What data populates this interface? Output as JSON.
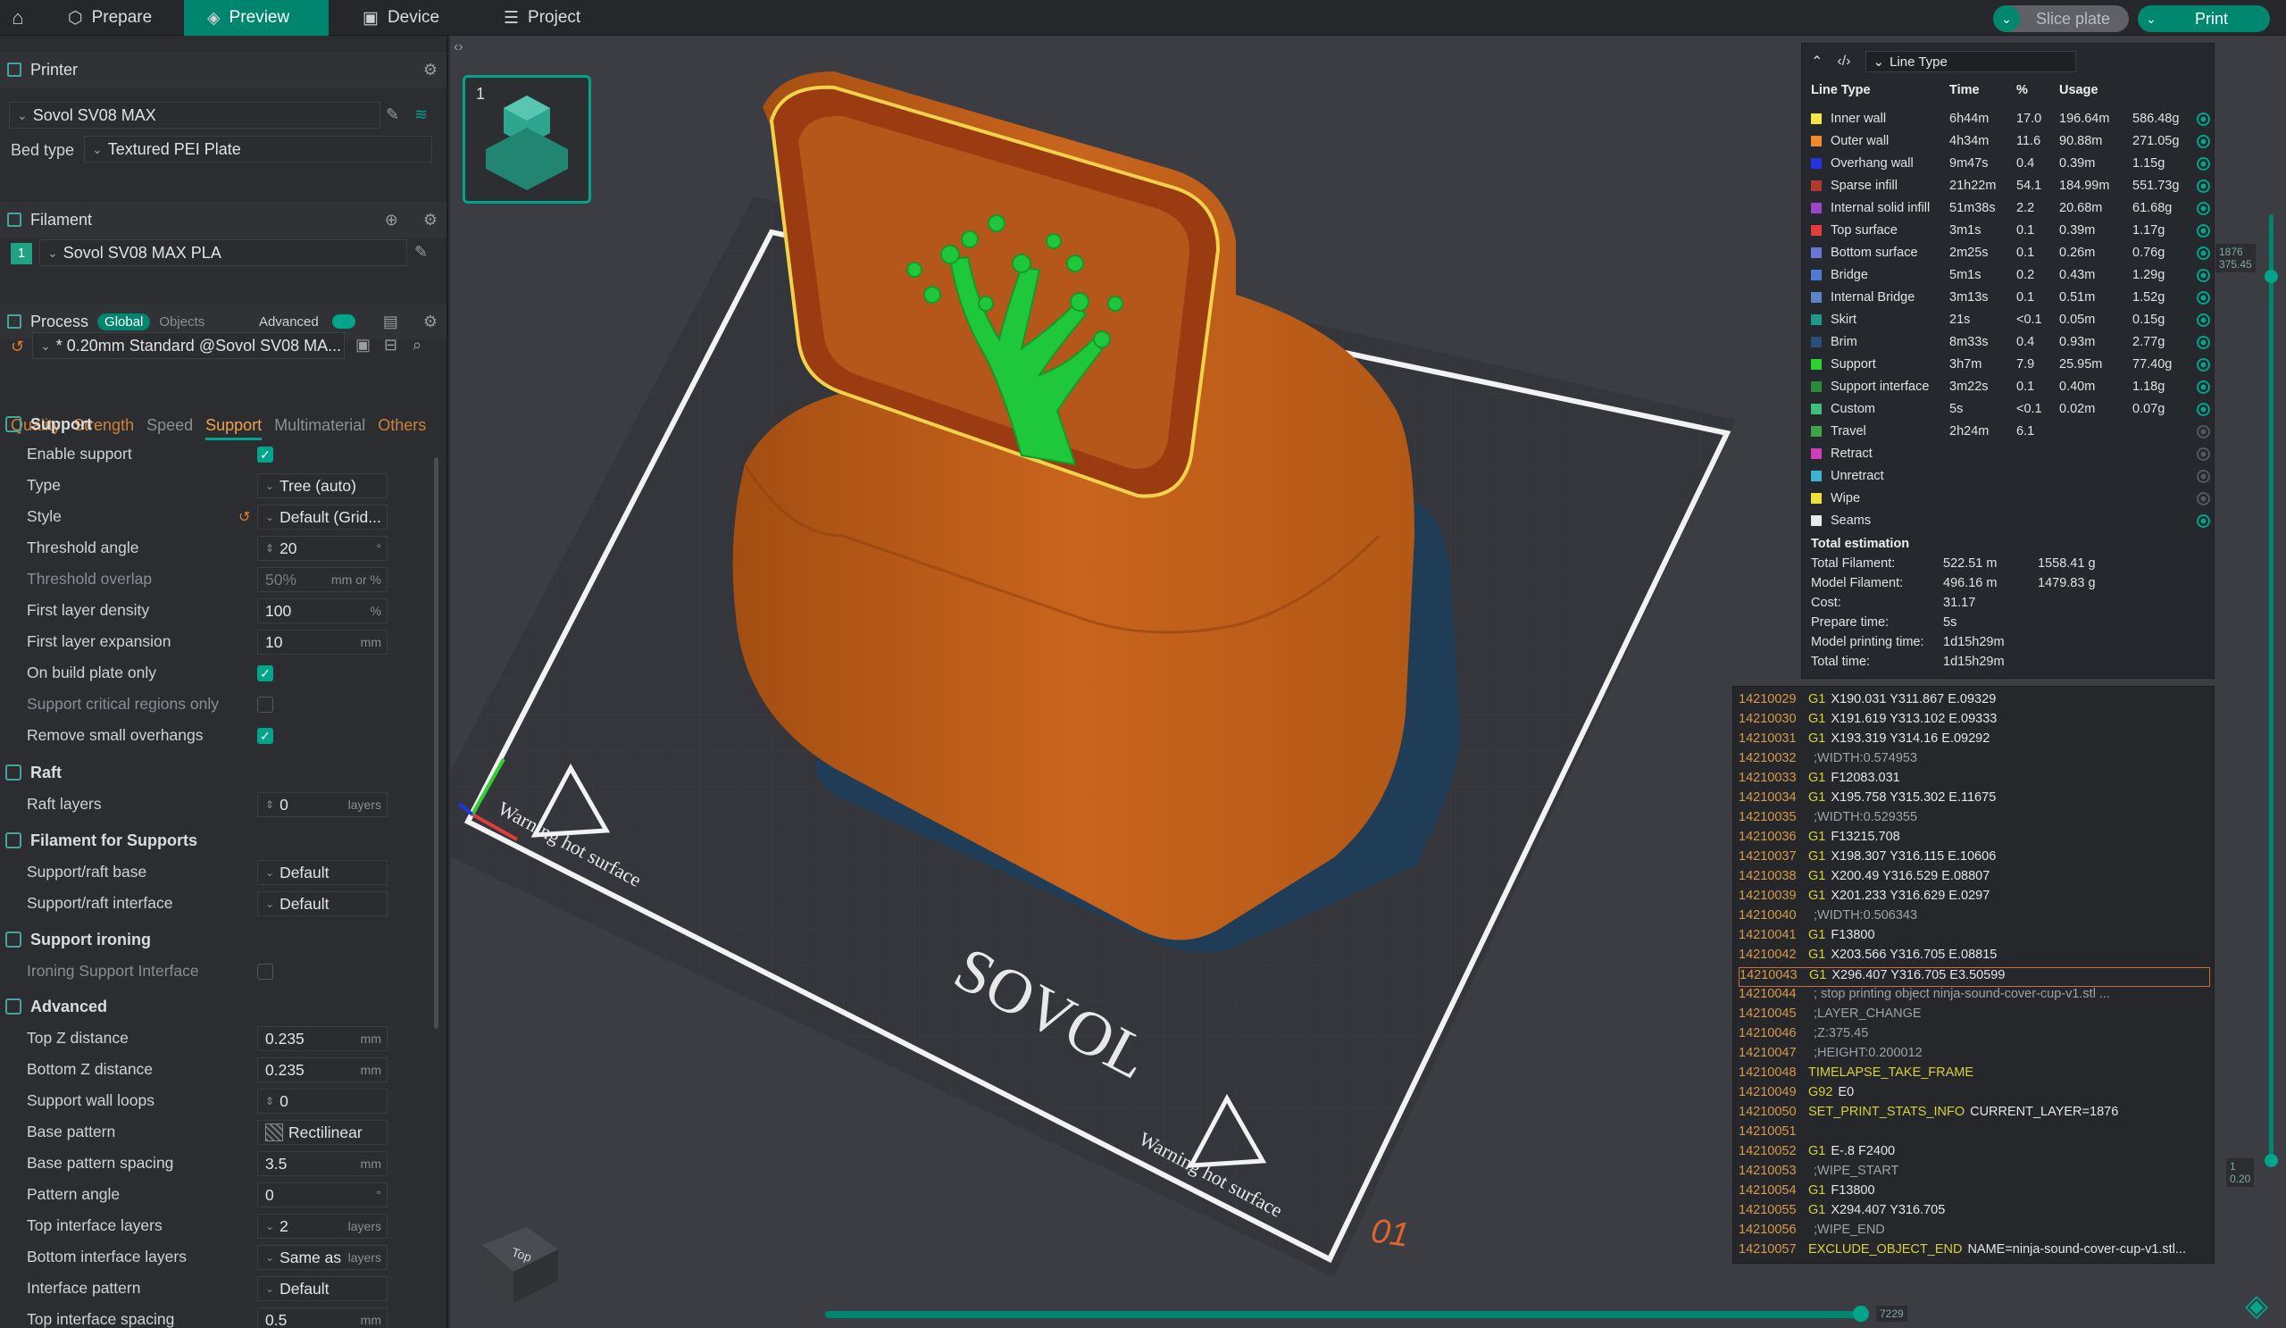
{
  "topbar": {
    "tabs": [
      {
        "label": "Prepare",
        "active": false
      },
      {
        "label": "Preview",
        "active": true
      },
      {
        "label": "Device",
        "active": false
      },
      {
        "label": "Project",
        "active": false
      }
    ],
    "slice_label": "Slice plate",
    "print_label": "Print"
  },
  "printer": {
    "title": "Printer",
    "name": "Sovol SV08 MAX",
    "bed_type_label": "Bed type",
    "bed_type_value": "Textured PEI Plate"
  },
  "filament": {
    "title": "Filament",
    "slot": "1",
    "name": "Sovol SV08 MAX PLA"
  },
  "process": {
    "title": "Process",
    "global": "Global",
    "objects": "Objects",
    "advanced": "Advanced",
    "preset": "* 0.20mm Standard @Sovol SV08 MA...",
    "tabs": [
      "Quality",
      "Strength",
      "Speed",
      "Support",
      "Multimaterial",
      "Others"
    ]
  },
  "support": {
    "group": "Support",
    "enable_label": "Enable support",
    "type_label": "Type",
    "type_value": "Tree (auto)",
    "style_label": "Style",
    "style_value": "Default (Grid...",
    "threshold_angle_label": "Threshold angle",
    "threshold_angle_value": "20",
    "threshold_angle_unit": "°",
    "threshold_overlap_label": "Threshold overlap",
    "threshold_overlap_value": "50%",
    "threshold_overlap_unit": "mm or %",
    "first_layer_density_label": "First layer density",
    "first_layer_density_value": "100",
    "first_layer_density_unit": "%",
    "first_layer_expansion_label": "First layer expansion",
    "first_layer_expansion_value": "10",
    "first_layer_expansion_unit": "mm",
    "on_build_plate_label": "On build plate only",
    "critical_regions_label": "Support critical regions only",
    "remove_small_label": "Remove small overhangs"
  },
  "raft": {
    "group": "Raft",
    "layers_label": "Raft layers",
    "layers_value": "0",
    "layers_unit": "layers"
  },
  "filament_supports": {
    "group": "Filament for Supports",
    "base_label": "Support/raft base",
    "base_value": "Default",
    "interface_label": "Support/raft interface",
    "interface_value": "Default"
  },
  "support_ironing": {
    "group": "Support ironing",
    "label": "Ironing Support Interface"
  },
  "advanced": {
    "group": "Advanced",
    "top_z_label": "Top Z distance",
    "top_z_value": "0.235",
    "top_z_unit": "mm",
    "bottom_z_label": "Bottom Z distance",
    "bottom_z_value": "0.235",
    "bottom_z_unit": "mm",
    "wall_loops_label": "Support wall loops",
    "wall_loops_value": "0",
    "base_pattern_label": "Base pattern",
    "base_pattern_value": "Rectilinear",
    "base_spacing_label": "Base pattern spacing",
    "base_spacing_value": "3.5",
    "base_spacing_unit": "mm",
    "pattern_angle_label": "Pattern angle",
    "pattern_angle_value": "0",
    "pattern_angle_unit": "°",
    "top_iface_label": "Top interface layers",
    "top_iface_value": "2",
    "top_iface_unit": "layers",
    "bottom_iface_label": "Bottom interface layers",
    "bottom_iface_value": "Same as",
    "bottom_iface_unit": "layers",
    "iface_pattern_label": "Interface pattern",
    "iface_pattern_value": "Default",
    "top_iface_spacing_label": "Top interface spacing",
    "top_iface_spacing_value": "0.5",
    "top_iface_spacing_unit": "mm"
  },
  "plate": {
    "number": "1",
    "bed_brand": "SOVOL",
    "warning": "Warning hot surface",
    "plate_id": "01",
    "view_cube_label": "Top"
  },
  "legend": {
    "selector": "Line Type",
    "headers": {
      "type": "Line Type",
      "time": "Time",
      "pct": "%",
      "usage": "Usage"
    },
    "rows": [
      {
        "name": "Inner wall",
        "time": "6h44m",
        "pct": "17.0",
        "len": "196.64m",
        "weight": "586.48g",
        "color": "#f5e44a",
        "visible": true
      },
      {
        "name": "Outer wall",
        "time": "4h34m",
        "pct": "11.6",
        "len": "90.88m",
        "weight": "271.05g",
        "color": "#f08a33",
        "visible": true
      },
      {
        "name": "Overhang wall",
        "time": "9m47s",
        "pct": "0.4",
        "len": "0.39m",
        "weight": "1.15g",
        "color": "#2233e0",
        "visible": true
      },
      {
        "name": "Sparse infill",
        "time": "21h22m",
        "pct": "54.1",
        "len": "184.99m",
        "weight": "551.73g",
        "color": "#b03a2e",
        "visible": true
      },
      {
        "name": "Internal solid infill",
        "time": "51m38s",
        "pct": "2.2",
        "len": "20.68m",
        "weight": "61.68g",
        "color": "#9b45c8",
        "visible": true
      },
      {
        "name": "Top surface",
        "time": "3m1s",
        "pct": "0.1",
        "len": "0.39m",
        "weight": "1.17g",
        "color": "#e33c3c",
        "visible": true
      },
      {
        "name": "Bottom surface",
        "time": "2m25s",
        "pct": "0.1",
        "len": "0.26m",
        "weight": "0.76g",
        "color": "#6a74d6",
        "visible": true
      },
      {
        "name": "Bridge",
        "time": "5m1s",
        "pct": "0.2",
        "len": "0.43m",
        "weight": "1.29g",
        "color": "#4f7ad1",
        "visible": true
      },
      {
        "name": "Internal Bridge",
        "time": "3m13s",
        "pct": "0.1",
        "len": "0.51m",
        "weight": "1.52g",
        "color": "#5a86c4",
        "visible": true
      },
      {
        "name": "Skirt",
        "time": "21s",
        "pct": "<0.1",
        "len": "0.05m",
        "weight": "0.15g",
        "color": "#1e9a8a",
        "visible": true
      },
      {
        "name": "Brim",
        "time": "8m33s",
        "pct": "0.4",
        "len": "0.93m",
        "weight": "2.77g",
        "color": "#2a4f7a",
        "visible": true
      },
      {
        "name": "Support",
        "time": "3h7m",
        "pct": "7.9",
        "len": "25.95m",
        "weight": "77.40g",
        "color": "#2fd12f",
        "visible": true
      },
      {
        "name": "Support interface",
        "time": "3m22s",
        "pct": "0.1",
        "len": "0.40m",
        "weight": "1.18g",
        "color": "#2b8a3a",
        "visible": true
      },
      {
        "name": "Custom",
        "time": "5s",
        "pct": "<0.1",
        "len": "0.02m",
        "weight": "0.07g",
        "color": "#3fbf7a",
        "visible": true
      },
      {
        "name": "Travel",
        "time": "2h24m",
        "pct": "6.1",
        "len": "",
        "weight": "",
        "color": "#3fa34a",
        "visible": false
      },
      {
        "name": "Retract",
        "time": "",
        "pct": "",
        "len": "",
        "weight": "",
        "color": "#d13fb8",
        "visible": false
      },
      {
        "name": "Unretract",
        "time": "",
        "pct": "",
        "len": "",
        "weight": "",
        "color": "#3fb3d1",
        "visible": false
      },
      {
        "name": "Wipe",
        "time": "",
        "pct": "",
        "len": "",
        "weight": "",
        "color": "#f0e03a",
        "visible": false
      },
      {
        "name": "Seams",
        "time": "",
        "pct": "",
        "len": "",
        "weight": "",
        "color": "#e8e8e8",
        "visible": true
      }
    ],
    "total_title": "Total estimation",
    "totals": [
      {
        "label": "Total Filament:",
        "v1": "522.51 m",
        "v2": "1558.41 g"
      },
      {
        "label": "Model Filament:",
        "v1": "496.16 m",
        "v2": "1479.83 g"
      },
      {
        "label": "Cost:",
        "v1": "31.17",
        "v2": ""
      },
      {
        "label": "Prepare time:",
        "v1": "5s",
        "v2": ""
      },
      {
        "label": "Model printing time:",
        "v1": "1d15h29m",
        "v2": ""
      },
      {
        "label": "Total time:",
        "v1": "1d15h29m",
        "v2": ""
      }
    ]
  },
  "gcode": [
    {
      "ln": "14210029",
      "op": "G1",
      "text": "X190.031 Y311.867 E.09329",
      "comment": false
    },
    {
      "ln": "14210030",
      "op": "G1",
      "text": "X191.619 Y313.102 E.09333",
      "comment": false
    },
    {
      "ln": "14210031",
      "op": "G1",
      "text": "X193.319 Y314.16 E.09292",
      "comment": false
    },
    {
      "ln": "14210032",
      "op": "",
      "text": ";WIDTH:0.574953",
      "comment": true
    },
    {
      "ln": "14210033",
      "op": "G1",
      "text": "F12083.031",
      "comment": false
    },
    {
      "ln": "14210034",
      "op": "G1",
      "text": "X195.758 Y315.302 E.11675",
      "comment": false
    },
    {
      "ln": "14210035",
      "op": "",
      "text": ";WIDTH:0.529355",
      "comment": true
    },
    {
      "ln": "14210036",
      "op": "G1",
      "text": "F13215.708",
      "comment": false
    },
    {
      "ln": "14210037",
      "op": "G1",
      "text": "X198.307 Y316.115 E.10606",
      "comment": false
    },
    {
      "ln": "14210038",
      "op": "G1",
      "text": "X200.49 Y316.529 E.08807",
      "comment": false
    },
    {
      "ln": "14210039",
      "op": "G1",
      "text": "X201.233 Y316.629 E.0297",
      "comment": false
    },
    {
      "ln": "14210040",
      "op": "",
      "text": ";WIDTH:0.506343",
      "comment": true
    },
    {
      "ln": "14210041",
      "op": "G1",
      "text": "F13800",
      "comment": false
    },
    {
      "ln": "14210042",
      "op": "G1",
      "text": "X203.566 Y316.705 E.08815",
      "comment": false
    },
    {
      "ln": "14210043",
      "op": "G1",
      "text": "X296.407 Y316.705 E3.50599",
      "comment": false
    },
    {
      "ln": "14210044",
      "op": "",
      "text": "; stop printing object ninja-sound-cover-cup-v1.stl ...",
      "comment": true
    },
    {
      "ln": "14210045",
      "op": "",
      "text": ";LAYER_CHANGE",
      "comment": true
    },
    {
      "ln": "14210046",
      "op": "",
      "text": ";Z:375.45",
      "comment": true
    },
    {
      "ln": "14210047",
      "op": "",
      "text": ";HEIGHT:0.200012",
      "comment": true
    },
    {
      "ln": "14210048",
      "op": "TIMELAPSE_TAKE_FRAME",
      "text": "",
      "comment": false
    },
    {
      "ln": "14210049",
      "op": "G92",
      "text": "E0",
      "comment": false
    },
    {
      "ln": "14210050",
      "op": "SET_PRINT_STATS_INFO",
      "text": "CURRENT_LAYER=1876",
      "comment": false
    },
    {
      "ln": "14210051",
      "op": "",
      "text": "",
      "comment": true
    },
    {
      "ln": "14210052",
      "op": "G1",
      "text": "E-.8 F2400",
      "comment": false
    },
    {
      "ln": "14210053",
      "op": "",
      "text": ";WIPE_START",
      "comment": true
    },
    {
      "ln": "14210054",
      "op": "G1",
      "text": "F13800",
      "comment": false
    },
    {
      "ln": "14210055",
      "op": "G1",
      "text": "X294.407 Y316.705",
      "comment": false
    },
    {
      "ln": "14210056",
      "op": "",
      "text": ";WIPE_END",
      "comment": true
    },
    {
      "ln": "14210057",
      "op": "EXCLUDE_OBJECT_END",
      "text": "NAME=ninja-sound-cover-cup-v1.stl...",
      "comment": false
    }
  ],
  "sliders": {
    "layer_top": "1876",
    "layer_top_z": "375.45",
    "layer_bottom": "1",
    "layer_bottom_z": "0.20",
    "move_value": "7229"
  }
}
